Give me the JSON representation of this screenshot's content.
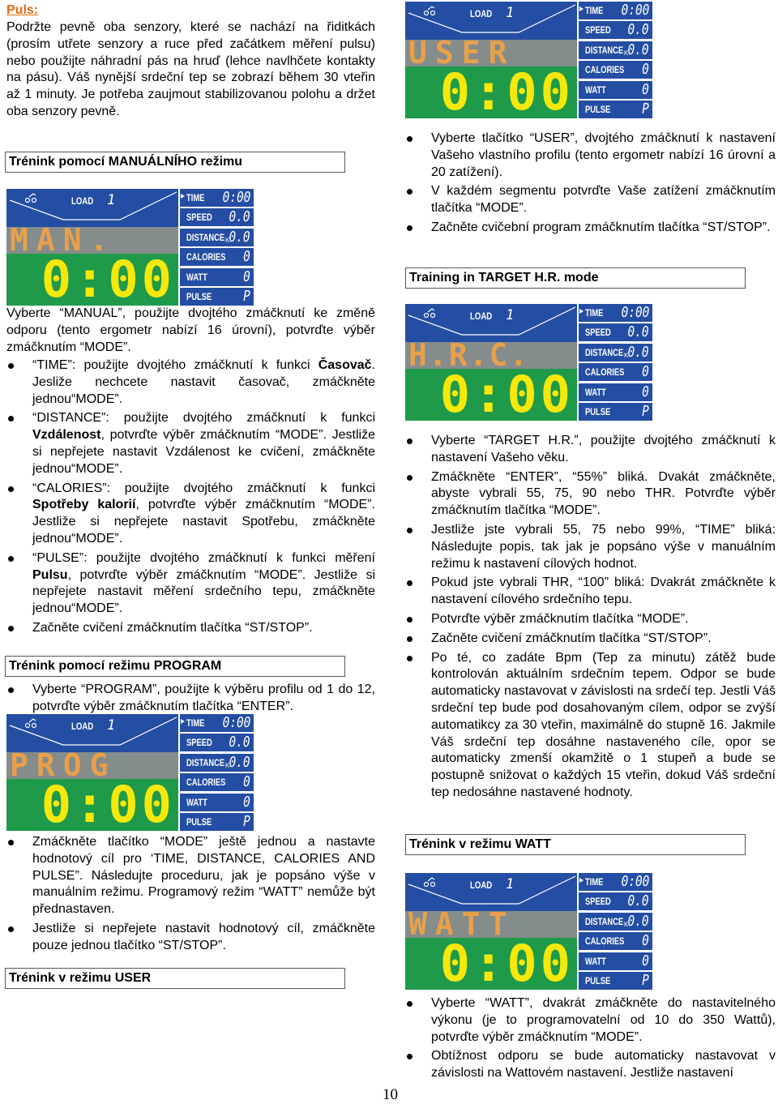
{
  "left_column": {
    "puls_heading": "Puls:",
    "puls_paragraph": "Podržte pevně oba senzory, které se nachází na řiditkách (prosím utřete senzory a ruce před začátkem měření pulsu) nebo použijte náhradní pás na hruď (lehce navlhčete kontakty na pásu). Váš nynější srdeční tep se zobrazí během 30 vteřin až 1 minuty. Je potřeba zaujmout stabilizovanou polohu a držet oba senzory pevně.",
    "manual_heading": "Trénink pomocí MANUÁLNÍHO režimu",
    "manual_intro": "Vyberte “MANUAL”, použijte dvojtého zmáčknutí ke změně odporu (tento ergometr nabízí 16 úrovní), potvrďte výběr zmáčknutím “MODE”.",
    "manual_bullets": [
      {
        "pre": "“TIME”: použijte dvojtého zmáčknutí k funkci ",
        "bold": "Časovač",
        "post": ". Jesliže nechcete nastavit časovač, zmáčkněte jednou“MODE”."
      },
      {
        "pre": "“DISTANCE”: použijte dvojtého zmáčknutí k funkci ",
        "bold": "Vzdálenost",
        "post": ", potvrďte výběr zmáčknutím “MODE”. Jestliže si nepřejete nastavit Vzdálenost ke cvičení, zmáčkněte jednou“MODE”."
      },
      {
        "pre": "“CALORIES”: použijte dvojtého zmáčknutí k funkci ",
        "bold": "Spotřeby kalorií",
        "post": ", potvrďte výběr zmáčknutím “MODE”. Jestliže si nepřejete nastavit Spotřebu, zmáčkněte jednou“MODE”."
      },
      {
        "pre": "“PULSE”: použijte dvojtého zmáčknutí k funkci měření ",
        "bold": "Pulsu",
        "post": ", potvrďte výběr zmáčknutím “MODE”. Jestliže si nepřejete nastavit měření srdečního tepu, zmáčkněte jednou“MODE”."
      },
      {
        "pre": "Začněte cvičení zmáčknutím tlačítka “ST/STOP”.",
        "bold": "",
        "post": ""
      }
    ],
    "program_heading": "Trénink pomocí režimu PROGRAM",
    "program_bullet_1": "Vyberte “PROGRAM”, použijte k výběru profilu od 1 do 12, potvrďte výběr zmáčknutím tlačítka “ENTER”.",
    "program_bullets_after": [
      "Zmáčkněte tlačítko “MODE” ještě jednou a nastavte hodnotový cíl pro ‘TIME, DISTANCE, CALORIES AND PULSE”. Následujte proceduru, jak je popsáno výše v manuálním režimu. Programový režim “WATT” nemůže být přednastaven.",
      "Jestliže si nepřejete nastavit hodnotový cíl, zmáčkněte pouze jednou tlačítko “ST/STOP”."
    ],
    "user_heading": "Trénink v režimu USER"
  },
  "right_column": {
    "user_bullets": [
      "Vyberte tlačítko “USER”, dvojtého zmáčknutí k nastavení Vašeho vlastního profilu (tento ergometr nabízí 16 úrovní a 20 zatížení).",
      "V každém segmentu potvrďte Vaše zatížení zmáčknutím tlačítka “MODE”.",
      "Začněte cvičební program zmáčknutím tlačítka “ST/STOP”."
    ],
    "hr_heading": "Training in TARGET H.R. mode",
    "hr_bullets": [
      "Vyberte “TARGET H.R.”, použijte dvojtého zmáčknutí k nastavení Vašeho věku.",
      "Zmáčkněte “ENTER”, “55%” bliká. Dvakát zmáčkněte, abyste vybrali 55, 75, 90 nebo THR. Potvrďte výběr zmáčknutím tlačítka “MODE”.",
      "Jestliže jste vybrali 55, 75 nebo 99%, “TIME” bliká: Následujte popis, tak jak je popsáno výše v manuálním režimu k nastavení cílových hodnot.",
      "Pokud jste vybrali THR, “100” bliká: Dvakrát zmáčkněte k nastavení cílového srdečního tepu.",
      "Potvrďte výběr zmáčknutím tlačítka “MODE”.",
      "Začněte cvičení zmáčknutím tlačítka “ST/STOP”.",
      "Po té, co zadáte Bpm (Tep za minutu) zátěž bude kontrolován aktuálním srdečním tepem. Odpor se bude automaticky nastavovat v závislosti na srdečí tep. Jestli Váš srdeční tep bude pod dosahovaným cílem, odpor se zvýší automatikcy za 30 vteřin, maximálně do stupně 16. Jakmile Váš srdeční tep dosáhne nastaveného cíle, opor se automaticky zmenší okamžitě o 1 stupeň a bude se postupně snižovat o každých 15 vteřin, dokud Váš srdeční tep nedosáhne nastavené hodnoty."
    ],
    "watt_heading": "Trénink v režimu WATT",
    "watt_bullets": [
      "Vyberte “WATT”, dvakrát zmáčkněte do nastavitelného výkonu (je to programovatelní od 10 do 350 Wattů), potvrďte výběr zmáčknutím “MODE”.",
      "Obtížnost odporu se bude automaticky nastavovat v závislosti na Wattovém nastavení. Jestliže nastavení"
    ]
  },
  "lcd_common": {
    "load_label": "LOAD",
    "load_value": "1",
    "clock": "0:00",
    "rows": [
      {
        "label": "TIME",
        "value": "0:00",
        "selected": true
      },
      {
        "label": "SPEED",
        "value": "0.0"
      },
      {
        "label": "DISTANCE",
        "unit": "K",
        "value": "0.0"
      },
      {
        "label": "CALORIES",
        "value": "0"
      },
      {
        "label": "WATT",
        "value": "0"
      },
      {
        "label": "PULSE",
        "value": "P"
      }
    ],
    "colors": {
      "panel_blue": "#244ea3",
      "matrix_gray": "#848c8c",
      "matrix_orange": "#e8a04a",
      "clock_green": "#1e9a4a",
      "clock_yellow": "#f5e80a"
    }
  },
  "lcd_words": {
    "manual": "MAN.",
    "program": "PROG",
    "user": "USER",
    "hrc": "H.R.C.",
    "watt": "WATT"
  },
  "page_number": "10"
}
